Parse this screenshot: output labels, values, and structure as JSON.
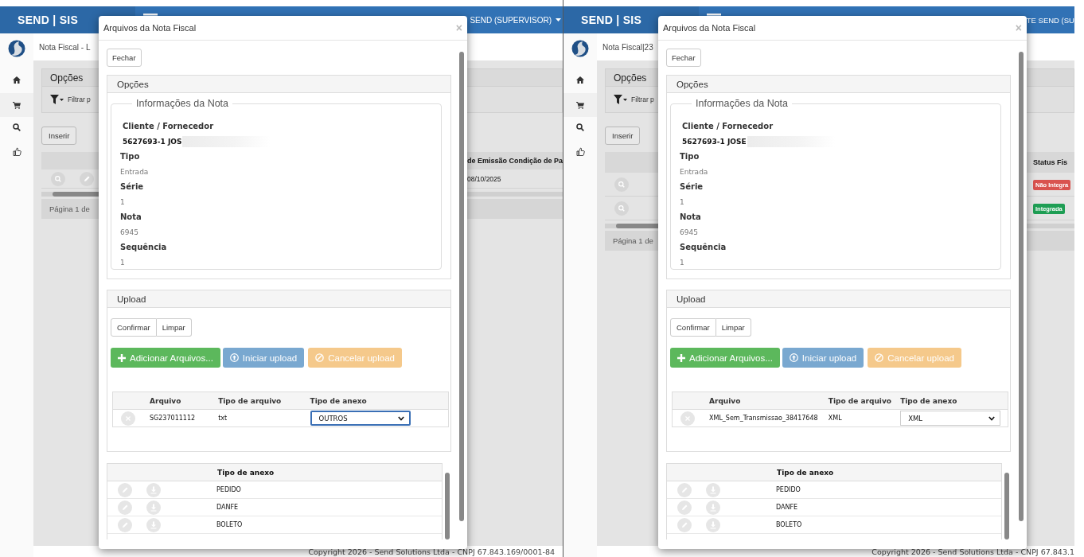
{
  "screens": [
    {
      "header": {
        "brand": "SEND | SIS",
        "user": "SEND (SUPERVISOR)",
        "user_caret": true
      },
      "breadcrumb": "Nota Fiscal - L",
      "options_panel": {
        "title": "Opções",
        "filter_label": "Filtrar p"
      },
      "insert_button": "Inserir",
      "grid": {
        "columns": [
          "de Emissão",
          "Condição de Pa"
        ],
        "rows": [
          {
            "kind": "editable",
            "cells": [
              {
                "kind": "text",
                "text": "08/10/2025"
              }
            ]
          }
        ]
      },
      "pager": "Página 1 de",
      "footer": "Copyright 2026 - Send Solutions Ltda - CNPJ 67.843.169/0001-84",
      "modal": {
        "title": "Arquivos da Nota Fiscal",
        "close": "×",
        "close_button": "Fechar",
        "options_title": "Opções",
        "legend": "Informações da Nota",
        "fields": [
          {
            "kind": "client",
            "label": "Cliente / Fornecedor",
            "value": "5627693-1 JOS",
            "redacted": true
          },
          {
            "kind": "plain",
            "label": "Tipo",
            "value": "Entrada"
          },
          {
            "kind": "plain",
            "label": "Série",
            "value": "1"
          },
          {
            "kind": "plain",
            "label": "Nota",
            "value": "6945"
          },
          {
            "kind": "plain",
            "label": "Sequência",
            "value": "1"
          }
        ],
        "upload": {
          "title": "Upload",
          "group_buttons": [
            "Confirmar",
            "Limpar"
          ],
          "action_buttons": [
            {
              "kind": "add",
              "label": "Adicionar Arquivos...",
              "disabled": false
            },
            {
              "kind": "start",
              "label": "Iniciar upload",
              "disabled": true
            },
            {
              "kind": "cancel",
              "label": "Cancelar upload",
              "disabled": true
            }
          ],
          "file_table": {
            "columns": [
              "Arquivo",
              "Tipo de arquivo",
              "Tipo de anexo"
            ],
            "rows": [
              {
                "file": "SG237011112",
                "type": "txt",
                "attachment_type": "OUTROS",
                "focused": true
              }
            ]
          }
        },
        "attachments": {
          "column": "Tipo de anexo",
          "rows": [
            "PEDIDO",
            "DANFE",
            "BOLETO"
          ]
        }
      }
    },
    {
      "header": {
        "brand": "SEND | SIS",
        "user": "TE SEND (SU",
        "user_caret": false
      },
      "breadcrumb": "Nota Fiscal|23",
      "options_panel": {
        "title": "Opções",
        "filter_label": "Filtrar p"
      },
      "insert_button": "Inserir",
      "grid": {
        "columns": [
          "Status Fis"
        ],
        "rows": [
          {
            "kind": "readonly",
            "cells": [
              {
                "kind": "badge",
                "text": "Não Integra",
                "color": "#d9534f"
              }
            ]
          },
          {
            "kind": "readonly",
            "cells": [
              {
                "kind": "badge",
                "text": "Integrada",
                "color": "#1e9e54"
              }
            ]
          }
        ]
      },
      "pager": "Página 1 de",
      "footer": "Copyright 2026 - Send Solutions Ltda - CNPJ 67.843.1",
      "modal": {
        "title": "Arquivos da Nota Fiscal",
        "close": "×",
        "close_button": "Fechar",
        "options_title": "Opções",
        "legend": "Informações da Nota",
        "fields": [
          {
            "kind": "client",
            "label": "Cliente / Fornecedor",
            "value": "5627693-1 JOSE",
            "redacted": true
          },
          {
            "kind": "plain",
            "label": "Tipo",
            "value": "Entrada"
          },
          {
            "kind": "plain",
            "label": "Série",
            "value": "1"
          },
          {
            "kind": "plain",
            "label": "Nota",
            "value": "6945"
          },
          {
            "kind": "plain",
            "label": "Sequência",
            "value": "1"
          }
        ],
        "upload": {
          "title": "Upload",
          "group_buttons": [
            "Confirmar",
            "Limpar"
          ],
          "action_buttons": [
            {
              "kind": "add",
              "label": "Adicionar Arquivos...",
              "disabled": false
            },
            {
              "kind": "start",
              "label": "Iniciar upload",
              "disabled": true
            },
            {
              "kind": "cancel",
              "label": "Cancelar upload",
              "disabled": true
            }
          ],
          "file_table": {
            "columns": [
              "Arquivo",
              "Tipo de arquivo",
              "Tipo de anexo"
            ],
            "rows": [
              {
                "file": "XML_Sem_Transmissao_38417648",
                "type": "XML",
                "attachment_type": "XML",
                "focused": false
              }
            ]
          }
        },
        "attachments": {
          "column": "Tipo de anexo",
          "rows": [
            "PEDIDO",
            "DANFE",
            "BOLETO"
          ]
        }
      }
    }
  ]
}
